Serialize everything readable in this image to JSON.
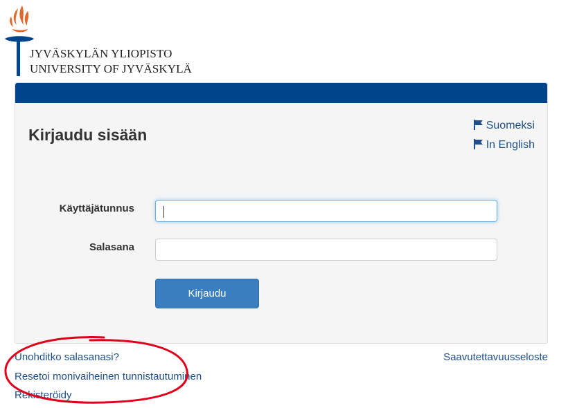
{
  "brand": {
    "name_fi": "JYVÄSKYLÄN YLIOPISTO",
    "name_en": "UNIVERSITY OF JYVÄSKYLÄ",
    "colors": {
      "header": "#00458c",
      "flame": "#e06a2c",
      "link": "#1f4f8a",
      "button": "#3a7ebf"
    }
  },
  "login": {
    "title": "Kirjaudu sisään",
    "languages": [
      {
        "label": "Suomeksi",
        "icon": "flag-icon"
      },
      {
        "label": "In English",
        "icon": "flag-icon"
      }
    ],
    "username": {
      "label": "Käyttäjätunnus",
      "value": "",
      "placeholder": ""
    },
    "password": {
      "label": "Salasana",
      "value": "",
      "placeholder": ""
    },
    "submit_label": "Kirjaudu"
  },
  "footer": {
    "links": [
      {
        "label": "Unohditko salasanasi?"
      },
      {
        "label": "Resetoi monivaiheinen tunnistautuminen"
      },
      {
        "label": "Rekisteröidy"
      }
    ],
    "accessibility": "Saavutettavuusseloste"
  },
  "annotation": {
    "shape": "ellipse",
    "color": "#e0001b"
  }
}
